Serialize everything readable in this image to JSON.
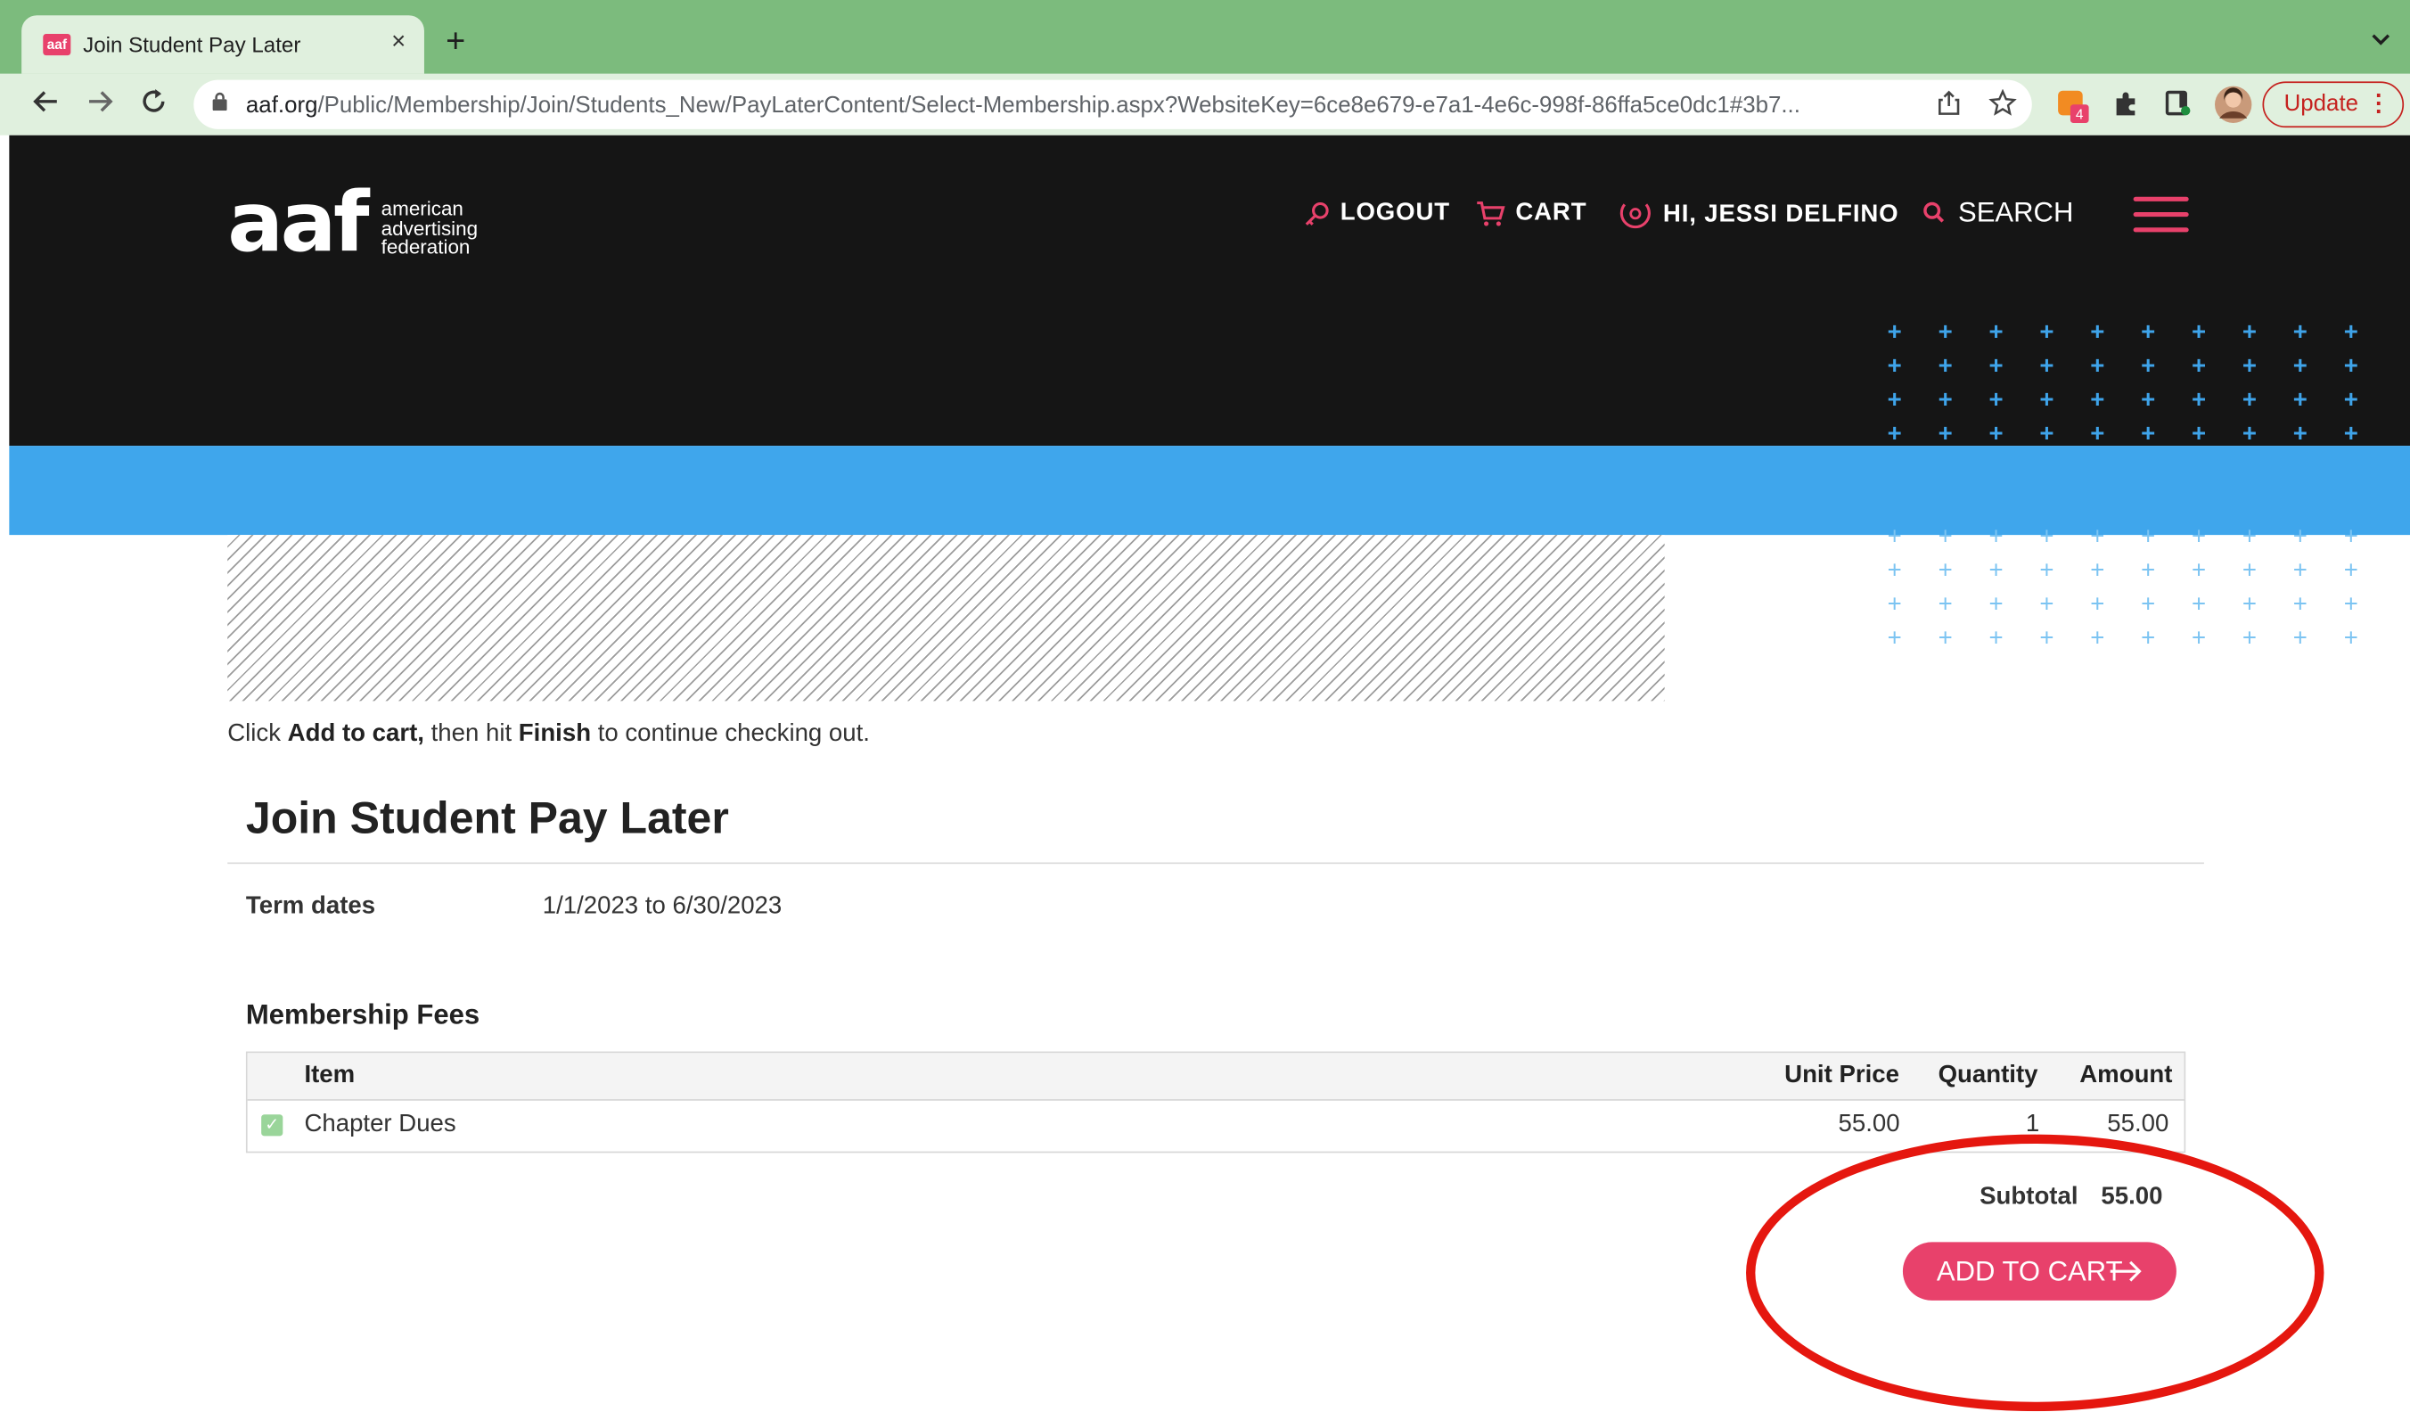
{
  "browser": {
    "tab_title": "Join Student Pay Later",
    "tab_favicon_text": "aaf",
    "tab_close": "×",
    "new_tab": "+",
    "url_host": "aaf.org",
    "url_path": "/Public/Membership/Join/Students_New/PayLaterContent/Select-Membership.aspx?WebsiteKey=6ce8e679-e7a1-4e6c-998f-86ffa5ce0dc1#3b7...",
    "update_label": "Update",
    "extension_badge": "4"
  },
  "site": {
    "logo_text": "aaf",
    "logo_sub": [
      "american",
      "advertising",
      "federation"
    ],
    "nav": {
      "logout": "LOGOUT",
      "cart": "CART",
      "greeting": "HI, JESSI DELFINO",
      "search": "SEARCH"
    },
    "accent_color": "#e8416b",
    "band_color": "#3fa6ec"
  },
  "content": {
    "instructions": {
      "pre": "Click ",
      "bold1": "Add to cart,",
      "mid": " then hit ",
      "bold2": "Finish",
      "post": " to continue checking out."
    },
    "title": "Join Student Pay Later",
    "term_label": "Term dates",
    "term_value": "1/1/2023 to 6/30/2023",
    "fees_heading": "Membership Fees",
    "table": {
      "headers": {
        "item": "Item",
        "unit_price": "Unit Price",
        "quantity": "Quantity",
        "amount": "Amount"
      },
      "rows": [
        {
          "checked": true,
          "item": "Chapter Dues",
          "unit_price": "55.00",
          "quantity": "1",
          "amount": "55.00"
        }
      ]
    },
    "subtotal_label": "Subtotal",
    "subtotal_value": "55.00",
    "add_to_cart": "ADD TO CART"
  }
}
